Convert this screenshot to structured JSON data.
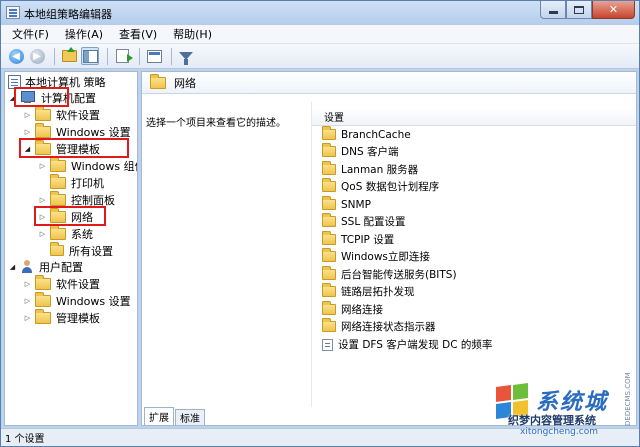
{
  "window": {
    "title": "本地组策略编辑器"
  },
  "menu": [
    "文件(F)",
    "操作(A)",
    "查看(V)",
    "帮助(H)"
  ],
  "tree": {
    "root": "本地计算机 策略",
    "computer": "计算机配置",
    "software_settings": "软件设置",
    "windows_settings": "Windows 设置",
    "admin_templates": "管理模板",
    "windows_components": "Windows 组件",
    "printers": "打印机",
    "control_panel": "控制面板",
    "network": "网络",
    "system": "系统",
    "all_settings": "所有设置",
    "user": "用户配置",
    "user_software_settings": "软件设置",
    "user_windows_settings": "Windows 设置",
    "user_admin_templates": "管理模板"
  },
  "right": {
    "header": "网络",
    "description": "选择一个项目来查看它的描述。",
    "column": "设置",
    "items": [
      {
        "label": "BranchCache",
        "icon": "folder"
      },
      {
        "label": "DNS 客户端",
        "icon": "folder"
      },
      {
        "label": "Lanman 服务器",
        "icon": "folder"
      },
      {
        "label": "QoS 数据包计划程序",
        "icon": "folder"
      },
      {
        "label": "SNMP",
        "icon": "folder"
      },
      {
        "label": "SSL 配置设置",
        "icon": "folder"
      },
      {
        "label": "TCPIP 设置",
        "icon": "folder"
      },
      {
        "label": "Windows立即连接",
        "icon": "folder"
      },
      {
        "label": "后台智能传送服务(BITS)",
        "icon": "folder"
      },
      {
        "label": "链路层拓扑发现",
        "icon": "folder"
      },
      {
        "label": "网络连接",
        "icon": "folder"
      },
      {
        "label": "网络连接状态指示器",
        "icon": "folder"
      },
      {
        "label": "设置 DFS 客户端发现 DC 的频率",
        "icon": "setting"
      }
    ]
  },
  "tabs": [
    "扩展",
    "标准"
  ],
  "status": "1 个设置",
  "watermark": {
    "big": "系统城",
    "cn": "织梦内容管理系统",
    "url": "xitongcheng.com",
    "side": "DEDECMS.COM"
  },
  "colors": {
    "highlight_box": "#e01a1a",
    "accent": "#2a6cc0"
  }
}
